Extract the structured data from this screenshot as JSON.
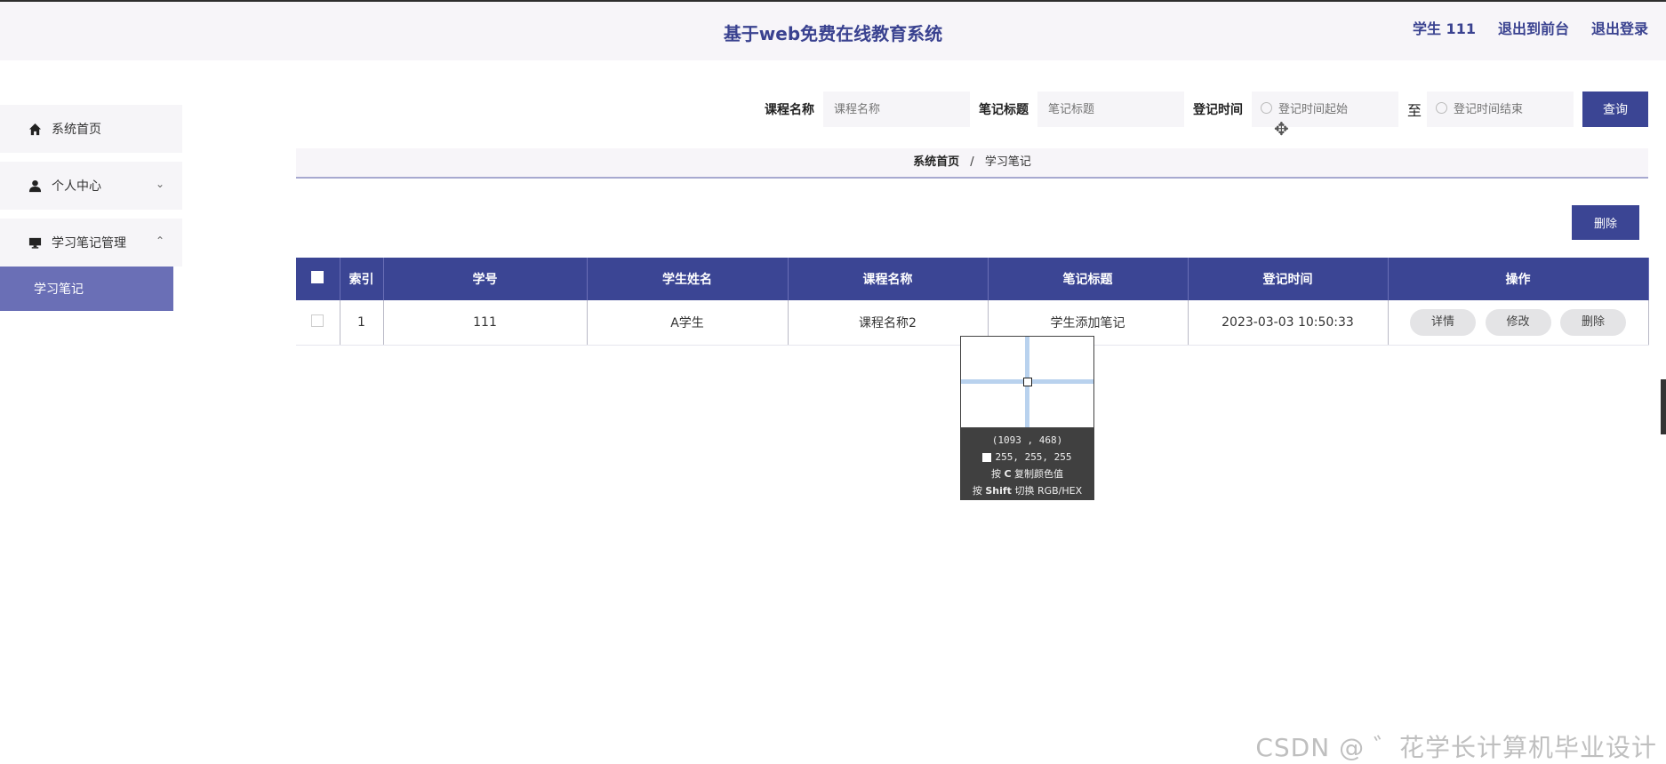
{
  "header": {
    "title": "基于web免费在线教育系统",
    "user_label": "学生 111",
    "back_label": "退出到前台",
    "logout_label": "退出登录"
  },
  "sidebar": {
    "items": [
      {
        "label": "系统首页",
        "icon": "home-icon"
      },
      {
        "label": "个人中心",
        "icon": "user-icon",
        "chevron": "⌄"
      },
      {
        "label": "学习笔记管理",
        "icon": "monitor-icon",
        "chevron": "⌃"
      }
    ],
    "submenu": {
      "label": "学习笔记"
    }
  },
  "search": {
    "course_label": "课程名称",
    "course_placeholder": "课程名称",
    "title_label": "笔记标题",
    "title_placeholder": "笔记标题",
    "time_label": "登记时间",
    "start_placeholder": "登记时间起始",
    "to_label": "至",
    "end_placeholder": "登记时间结束",
    "query_label": "查询"
  },
  "breadcrumb": {
    "home": "系统首页",
    "sep": "/",
    "current": "学习笔记"
  },
  "actions": {
    "delete_label": "删除"
  },
  "table": {
    "headers": [
      "索引",
      "学号",
      "学生姓名",
      "课程名称",
      "笔记标题",
      "登记时间",
      "操作"
    ],
    "rows": [
      {
        "index": "1",
        "student_no": "111",
        "student_name": "A学生",
        "course": "课程名称2",
        "note_title": "学生添加笔记",
        "time": "2023-03-03 10:50:33"
      }
    ],
    "ops": {
      "detail": "详情",
      "edit": "修改",
      "delete": "删除"
    }
  },
  "picker": {
    "coords": "(1093 , 468)",
    "rgb": "255, 255, 255",
    "hint1_prefix": "按 ",
    "hint1_key": "C",
    "hint1_suffix": " 复制颜色值",
    "hint2_prefix": "按 ",
    "hint2_key": "Shift",
    "hint2_suffix": " 切换 RGB/HEX"
  },
  "watermark": "CSDN @ ゛花学长计算机毕业设计",
  "colors": {
    "primary": "#3b4594",
    "active_menu": "#6a6fb6",
    "title": "#3a4290"
  }
}
